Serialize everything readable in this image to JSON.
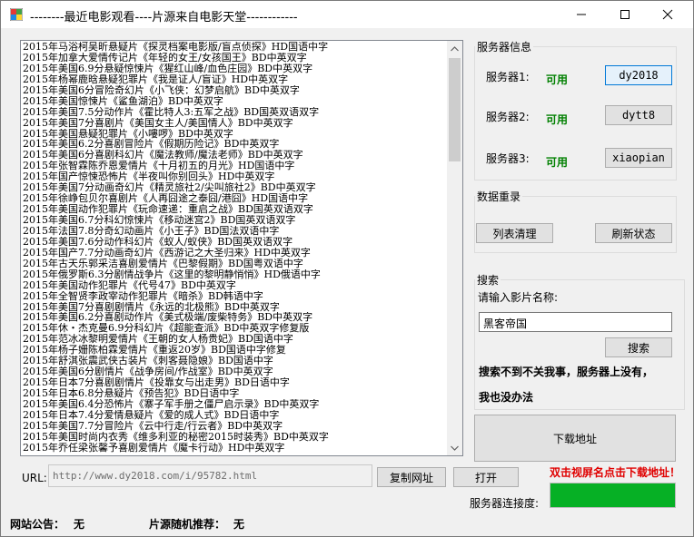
{
  "window": {
    "title": "--------最近电影观看----片源来自电影天堂------------"
  },
  "movie_list": {
    "items": [
      "2015年马浴柯吴昕悬疑片《探灵档案电影版/盲点侦探》HD国语中字",
      "2015年加拿大爱情传记片《年轻的女王/女孩国王》BD中英双字",
      "2015年美国6.9分悬疑惊悚片《猩红山峰/血色庄园》BD中英双字",
      "2015年杨幂鹿晗悬疑犯罪片《我是证人/盲证》HD中英双字",
      "2015年美国6分冒险奇幻片《小飞侠：幻梦启航》BD中英双字",
      "2015年美国惊悚片《鲨鱼湖泊》BD中英双字",
      "2015年美国7.5分动作片《霍比特人3:五军之战》BD国英双语双字",
      "2015年美国7分喜剧片《美国女主人/美国情人》BD中英双字",
      "2015年美国悬疑犯罪片《小嘍啰》BD中英双字",
      "2015年美国6.2分喜剧冒险片《假期历险记》BD中英双字",
      "2015年美国6分喜剧科幻片《魔法教师/魔法老师》BD中英双字",
      "2015年张智霖陈乔恩爱情片《十月初五的月光》HD国语中字",
      "2015年国产惊悚恐怖片《半夜叫你别回头》HD中英双字",
      "2015年美国7分动画奇幻片《精灵旅社2/尖叫旅社2》BD中英双字",
      "2015年徐峥包贝尔喜剧片《人再囧途之泰囧/港囧》HD国语中字",
      "2015年美国动作犯罪片《玩命速递：重启之战》BD国英双语双字",
      "2015年美国6.7分科幻惊悚片《移动迷宫2》BD国英双语双字",
      "2015年法国7.8分奇幻动画片《小王子》BD国法双语中字",
      "2015年美国7.6分动作科幻片《蚁人/蚁侠》BD国英双语双字",
      "2015年国产7.7分动画奇幻片《西游记之大圣归来》HD中英双字",
      "2015年古天乐郭采洁喜剧爱情片《巴黎假期》BD国粤双语中字",
      "2015年俄罗斯6.3分剧情战争片《这里的黎明静悄悄》HD俄语中字",
      "2015年美国动作犯罪片《代号47》BD中英双字",
      "2015年全智贤李政宰动作犯罪片《暗杀》BD韩语中字",
      "2015年美国7分喜剧剧情片《永远的北极熊》BD中英双字",
      "2015年美国6.2分喜剧动作片《美式极端/废柴特务》BD中英双字",
      "2015年休・杰克曼6.9分科幻片《超能查派》BD中英双字修复版",
      "2015年范冰冰黎明爱情片《王朝的女人杨贵妃》BD国语中字",
      "2015年杨子姗陈柏霖爱情片《重返20岁》BD国语中字修复",
      "2015年舒淇张震武侠古装片《刺客聂隐娘》BD国语中字",
      "2015年美国6分剧情片《战争房间/作战室》BD中英双字",
      "2015年日本7分喜剧剧情片《投靠女与出走男》BD日语中字",
      "2015年日本6.8分悬疑片《预告犯》BD日语中字",
      "2015年美国6.4分恐怖片《寨子军手册之僵尸启示录》BD中英双字",
      "2015年日本7.4分爱情悬疑片《爱的成人式》BD日语中字",
      "2015年美国7.7分冒险片《云中行走/行云者》BD中英双字",
      "2015年美国时尚内衣秀《维多利亚的秘密2015时装秀》BD中英双字",
      "2015年乔任梁张馨予喜剧爱情片《魔卡行动》HD中英双字"
    ]
  },
  "servers": {
    "group_label": "服务器信息",
    "rows": [
      {
        "label": "服务器1:",
        "status": "可用",
        "button": "dy2018"
      },
      {
        "label": "服务器2:",
        "status": "可用",
        "button": "dytt8"
      },
      {
        "label": "服务器3:",
        "status": "可用",
        "button": "xiaopian"
      }
    ]
  },
  "data_reset": {
    "group_label": "数据重录",
    "clear_list_label": "列表清理",
    "refresh_status_label": "刷新状态"
  },
  "search": {
    "group_label": "搜索",
    "prompt": "请输入影片名称:",
    "value": "黑客帝国",
    "button_label": "搜索",
    "note_line1": "搜索不到不关我事，服务器上没有，",
    "note_line2": "我也没办法"
  },
  "download": {
    "button_label": "下载地址",
    "hint": "双击视屏名点击下载地址！"
  },
  "url_bar": {
    "label": "URL:",
    "value": "http://www.dy2018.com/i/95782.html",
    "copy_label": "复制网址",
    "open_label": "打开"
  },
  "connection": {
    "label": "服务器连接度:",
    "progress": 1.0
  },
  "status_bar": {
    "notice_label": "网站公告：",
    "notice_value": "无",
    "random_label": "片源随机推荐：",
    "random_value": "无"
  },
  "colors": {
    "status_ok": "#008000",
    "hint_red": "#e00000",
    "progress_green": "#06b025"
  }
}
